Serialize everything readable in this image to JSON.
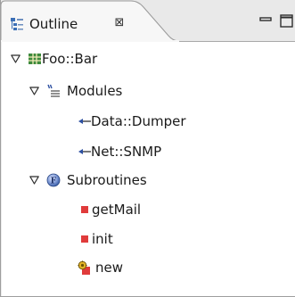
{
  "view": {
    "title": "Outline",
    "close_symbol": "⊠",
    "minimize": "minimize-icon",
    "maximize": "maximize-icon"
  },
  "tree": {
    "root": {
      "label": "Foo::Bar",
      "icon": "package-icon",
      "expanded": true
    },
    "modules": {
      "label": "Modules",
      "icon": "modules-icon",
      "expanded": true,
      "items": [
        {
          "label": "Data::Dumper",
          "icon": "module-import-icon"
        },
        {
          "label": "Net::SNMP",
          "icon": "module-import-icon"
        }
      ]
    },
    "subroutines": {
      "label": "Subroutines",
      "icon": "subroutines-icon",
      "expanded": true,
      "items": [
        {
          "label": "getMail",
          "icon": "sub-method-icon"
        },
        {
          "label": "init",
          "icon": "sub-method-icon"
        },
        {
          "label": "new",
          "icon": "constructor-icon"
        }
      ]
    }
  },
  "colors": {
    "method_red": "#e03b3b",
    "package_green": "#2f7a2f",
    "subroutines_blue": "#3b5fa8",
    "tree_background": "#ffffff",
    "tabbar_background": "#e9e9e9"
  }
}
